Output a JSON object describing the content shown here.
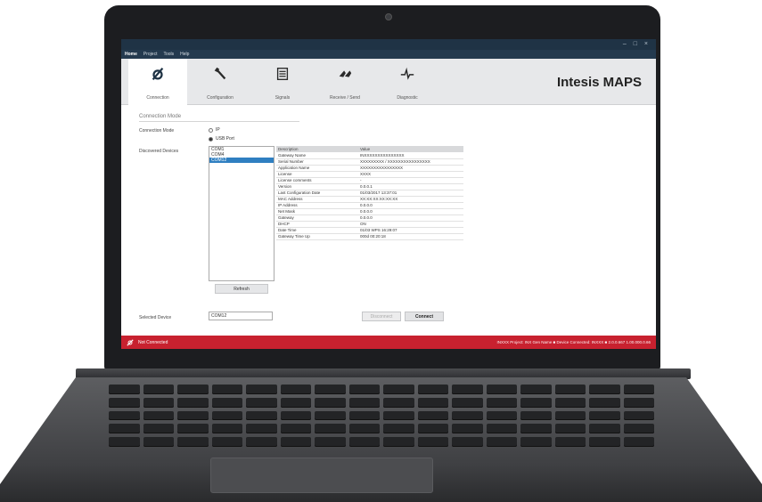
{
  "window": {
    "controls": "– □ ×"
  },
  "menu": [
    "Home",
    "Project",
    "Tools",
    "Help"
  ],
  "tabs": [
    {
      "label": "Connection",
      "icon": "connection-icon"
    },
    {
      "label": "Configuration",
      "icon": "wrench-icon"
    },
    {
      "label": "Signals",
      "icon": "list-icon"
    },
    {
      "label": "Receive / Send",
      "icon": "transfer-icon"
    },
    {
      "label": "Diagnostic",
      "icon": "diagnostic-icon"
    }
  ],
  "brand": "Intesis MAPS",
  "section_title": "Connection Mode",
  "connection_mode": {
    "label": "Connection Mode",
    "ip": "IP",
    "usb": "USB Port"
  },
  "discovered": {
    "label": "Discovered Devices",
    "ports": [
      "COM1",
      "COM4",
      "COM12"
    ],
    "refresh": "Refresh"
  },
  "props": {
    "headers": [
      "Description",
      "Value"
    ],
    "rows": [
      [
        "Gateway Name",
        "INXXXXXXXXXXXXXXX"
      ],
      [
        "Serial Number",
        "XXXXXXXXX / XXXXXXXXXXXXXXXX"
      ],
      [
        "Application Name",
        "XXXXXXXXXXXXXXXX"
      ],
      [
        "License",
        "XXXX"
      ],
      [
        "License comments",
        "-"
      ],
      [
        "Version",
        "0.0.0.1"
      ],
      [
        "Last Configuration Date",
        "01/03/2017 13:37:01"
      ],
      [
        "MAC Address",
        "XX:XX:XX:XX:XX:XX"
      ],
      [
        "IP Address",
        "0.0.0.0"
      ],
      [
        "Net Mask",
        "0.0.0.0"
      ],
      [
        "Gateway",
        "0.0.0.0"
      ],
      [
        "DHCP",
        "ON"
      ],
      [
        "Date Time",
        "01/03 WPS 16:29:07"
      ],
      [
        "Gateway Time Up",
        "000d 00:20:18"
      ]
    ]
  },
  "selected_device": {
    "label": "Selected Device",
    "value": "COM12"
  },
  "buttons": {
    "disconnect": "Disconnect",
    "connect": "Connect"
  },
  "status": {
    "text": "Not Connected",
    "right": "INXXX Project: INX Gen Name  ■  Device Connected: INXXX  ■  2.0.0.667 1.00.000.0.66"
  },
  "colors": {
    "status_bar": "#c8212f",
    "title_bar": "#1f3345",
    "selection": "#2f7fc1"
  }
}
